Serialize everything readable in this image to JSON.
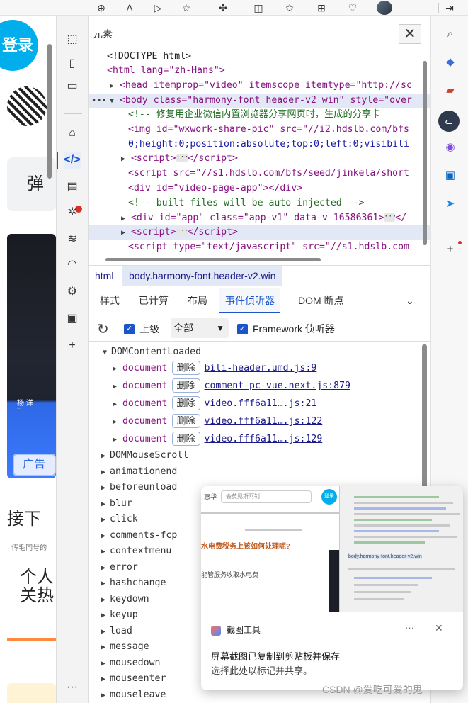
{
  "browser_toolbar": {
    "icons": [
      "zoom-icon",
      "read-aloud-icon",
      "media-icon",
      "favorite-icon",
      "extensions-icon",
      "split-screen-icon",
      "favorites-list-icon",
      "collections-icon",
      "performance-icon",
      "profile-avatar",
      "sidebar-toggle-icon"
    ]
  },
  "page": {
    "login_label": "登录",
    "danmu_text": "弹",
    "video_author": "杨 洋",
    "ad_label": "广告",
    "next_heading": "接下",
    "small_text": "· 传毛同号的",
    "person_line1": "个人",
    "person_line2": "关热"
  },
  "devtools": {
    "panel_title": "元素",
    "code_lines": [
      {
        "kind": "doctype",
        "text": "<!DOCTYPE html>"
      },
      {
        "kind": "open",
        "text": "<html lang=\"zh-Hans\">"
      },
      {
        "kind": "head",
        "text": "<head itemprop=\"video\" itemscope itemtype=\"http://sc"
      },
      {
        "kind": "body",
        "text": "<body class=\"harmony-font header-v2 win\" style=\"over"
      },
      {
        "kind": "comment",
        "text": "<!-- 修复用企业微信内置浏览器分享网页时，生成的分享卡"
      },
      {
        "kind": "img",
        "text": "<img id=\"wxwork-share-pic\" src=\"//i2.hdslb.com/bfs"
      },
      {
        "kind": "cont",
        "text": "0;height:0;position:absolute;top:0;left:0;visibili"
      },
      {
        "kind": "script",
        "text": "<script>"
      },
      {
        "kind": "scriptsrc",
        "text": "<script src=\"//s1.hdslb.com/bfs/seed/jinkela/short"
      },
      {
        "kind": "div",
        "text": "<div id=\"video-page-app\"></div>"
      },
      {
        "kind": "comment",
        "text": "<!-- built files will be auto injected -->"
      },
      {
        "kind": "divapp",
        "text": "<div id=\"app\" class=\"app-v1\" data-v-16586361>"
      },
      {
        "kind": "script",
        "text": "<script>"
      },
      {
        "kind": "scripttype",
        "text": "<script type=\"text/javascript\" src=\"//s1.hdslb.com"
      }
    ],
    "breadcrumbs": [
      "html",
      "body.harmony-font.header-v2.win"
    ],
    "tabs": [
      "样式",
      "已计算",
      "布局",
      "事件侦听器",
      "DOM 断点"
    ],
    "active_tab": "事件侦听器",
    "filter": {
      "ancestors_label": "上级",
      "select_value": "全部",
      "framework_label": "Framework 侦听器"
    },
    "expanded_event": "DOMContentLoaded",
    "remove_label": "删除",
    "listeners": [
      {
        "target": "document",
        "source": "bili-header.umd.js:9"
      },
      {
        "target": "document",
        "source": "comment-pc-vue.next.js:879"
      },
      {
        "target": "document",
        "source": "video.fff6a11….js:21"
      },
      {
        "target": "document",
        "source": "video.fff6a11….js:122"
      },
      {
        "target": "document",
        "source": "video.fff6a11….js:129"
      }
    ],
    "events": [
      "DOMMouseScroll",
      "animationend",
      "beforeunload",
      "blur",
      "click",
      "comments-fcp",
      "contextmenu",
      "error",
      "hashchange",
      "keydown",
      "keyup",
      "load",
      "message",
      "mousedown",
      "mouseenter",
      "mouseleave"
    ]
  },
  "toast": {
    "app_name": "截图工具",
    "message": "屏幕截图已复制到剪贴板并保存",
    "sub_message": "选择此处以标记并共享。",
    "menu_label": "···",
    "close_label": "✕",
    "thumb_search": "会英见斯阿钊",
    "thumb_login": "登录",
    "thumb_headline": "水电费税务上该如何处理呢?",
    "thumb_line": "能管服务收取水电费",
    "thumb_crumb": "body.harmony-font.header-v2.win"
  },
  "watermark": "CSDN @爱吃可爱的鬼"
}
